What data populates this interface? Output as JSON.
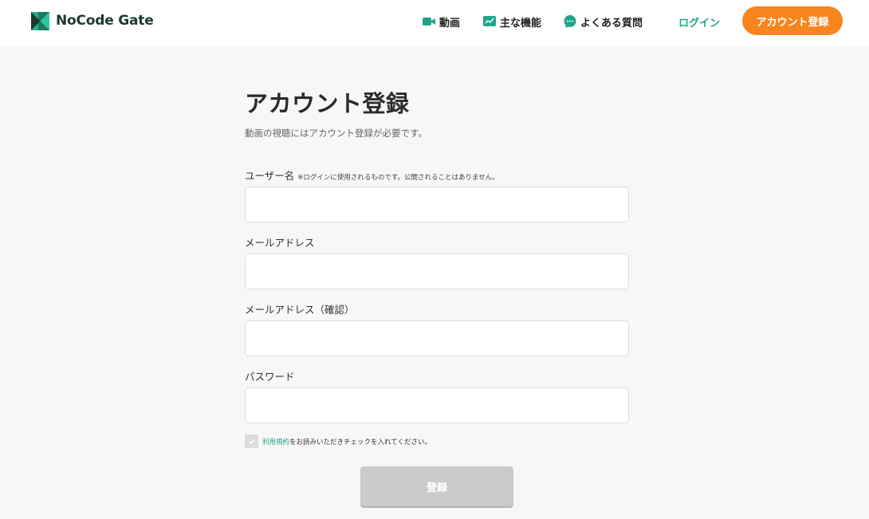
{
  "header": {
    "logo_text": "NoCode Gate",
    "nav": {
      "video": "動画",
      "features": "主な機能",
      "faq": "よくある質問"
    },
    "login_label": "ログイン",
    "register_label": "アカウント登録"
  },
  "form": {
    "title": "アカウント登録",
    "subtitle": "動画の視聴にはアカウント登録が必要です。",
    "username_label": "ユーザー名",
    "username_note": "※ログインに使用されるものです。公開されることはありません。",
    "username_value": "",
    "email_label": "メールアドレス",
    "email_value": "",
    "email_confirm_label": "メールアドレス（確認）",
    "email_confirm_value": "",
    "password_label": "パスワード",
    "password_value": "",
    "terms_link": "利用規約",
    "terms_text": "をお読みいただきチェックを入れてください。",
    "terms_checked": false,
    "submit_label": "登録"
  },
  "colors": {
    "accent_green": "#1ea58c",
    "brand_orange": "#f7851e",
    "disabled_button": "#c9ccc9",
    "background": "#f7f7f7"
  },
  "icons": {
    "logo": "nocode-gate-logo-icon",
    "video": "video-camera-icon",
    "features": "chart-icon",
    "faq": "chat-bubble-icon",
    "checkbox": "check-icon"
  }
}
